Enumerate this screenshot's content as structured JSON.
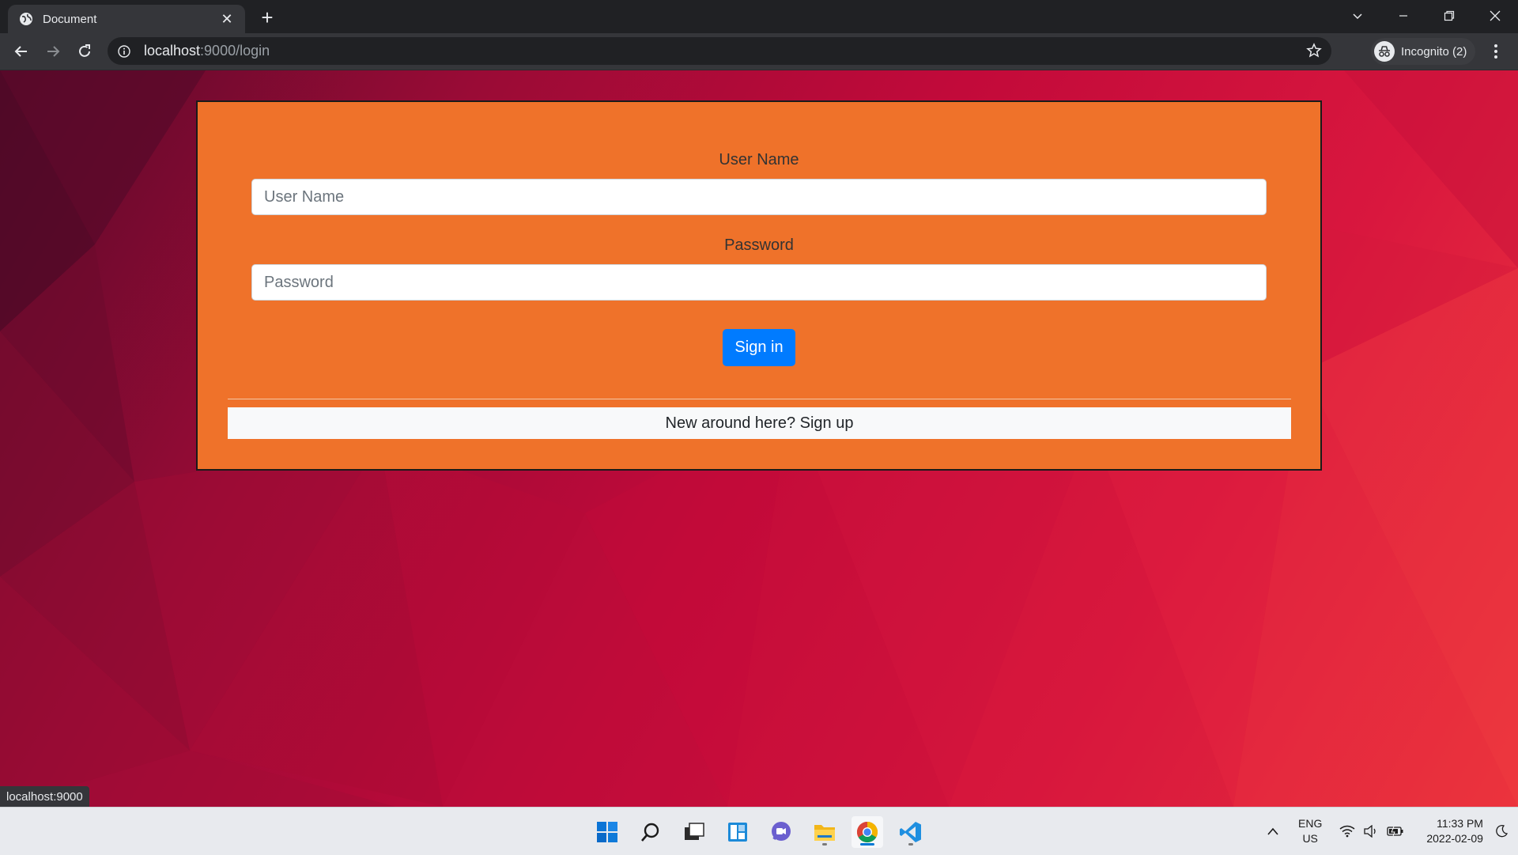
{
  "browser": {
    "tab_title": "Document",
    "url_host": "localhost",
    "url_path": ":9000/login",
    "profile_label": "Incognito (2)"
  },
  "form": {
    "username_label": "User Name",
    "username_placeholder": "User Name",
    "password_label": "Password",
    "password_placeholder": "Password",
    "submit_label": "Sign in",
    "signup_text": "New around here? Sign up"
  },
  "status_bar": {
    "url": "localhost:9000"
  },
  "taskbar": {
    "apps": [
      "start-icon",
      "search-icon",
      "task-view-icon",
      "widgets-icon",
      "chat-icon",
      "file-explorer-icon",
      "chrome-icon",
      "vscode-icon"
    ],
    "lang_top": "ENG",
    "lang_bottom": "US",
    "time": "11:33 PM",
    "date": "2022-02-09"
  },
  "colors": {
    "card": "#ef722a",
    "button": "#007bff",
    "background_start": "#5a0a2a",
    "background_end": "#ef3a3d"
  }
}
